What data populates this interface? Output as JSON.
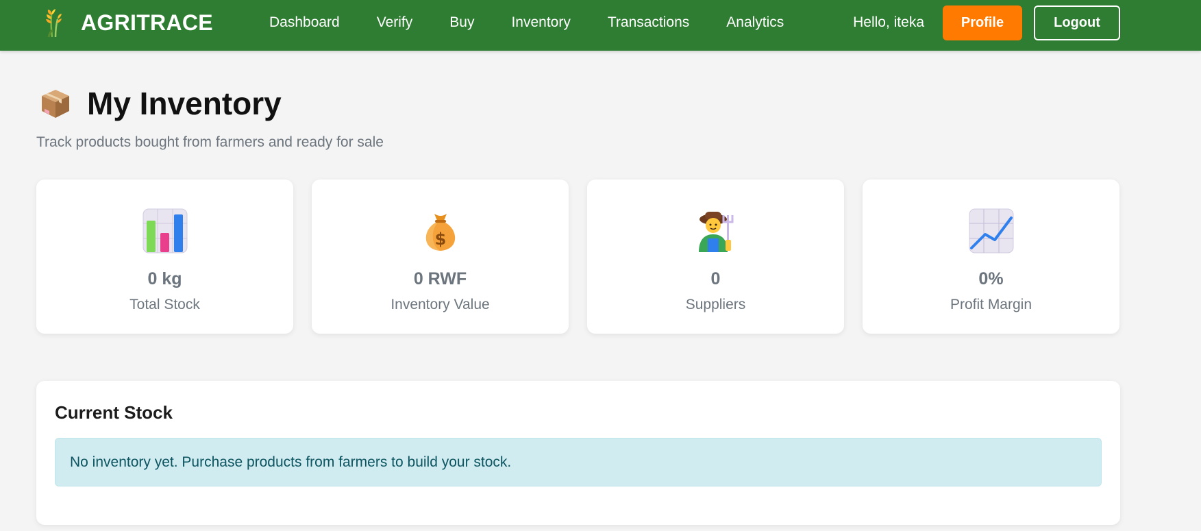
{
  "navbar": {
    "brand": "AGRITRACE",
    "links": [
      "Dashboard",
      "Verify",
      "Buy",
      "Inventory",
      "Transactions",
      "Analytics"
    ],
    "greeting": "Hello, iteka",
    "profile_label": "Profile",
    "logout_label": "Logout",
    "colors": {
      "bar": "#2e7d32",
      "profile": "#ff7a00"
    }
  },
  "page": {
    "title": "My Inventory",
    "title_icon": "package-icon",
    "subtitle": "Track products bought from farmers and ready for sale"
  },
  "stats": [
    {
      "icon": "bar-chart-icon",
      "value": "0 kg",
      "label": "Total Stock"
    },
    {
      "icon": "money-bag-icon",
      "value": "0 RWF",
      "label": "Inventory Value"
    },
    {
      "icon": "farmer-icon",
      "value": "0",
      "label": "Suppliers"
    },
    {
      "icon": "trend-up-icon",
      "value": "0%",
      "label": "Profit Margin"
    }
  ],
  "stock": {
    "title": "Current Stock",
    "empty_message": "No inventory yet. Purchase products from farmers to build your stock."
  }
}
